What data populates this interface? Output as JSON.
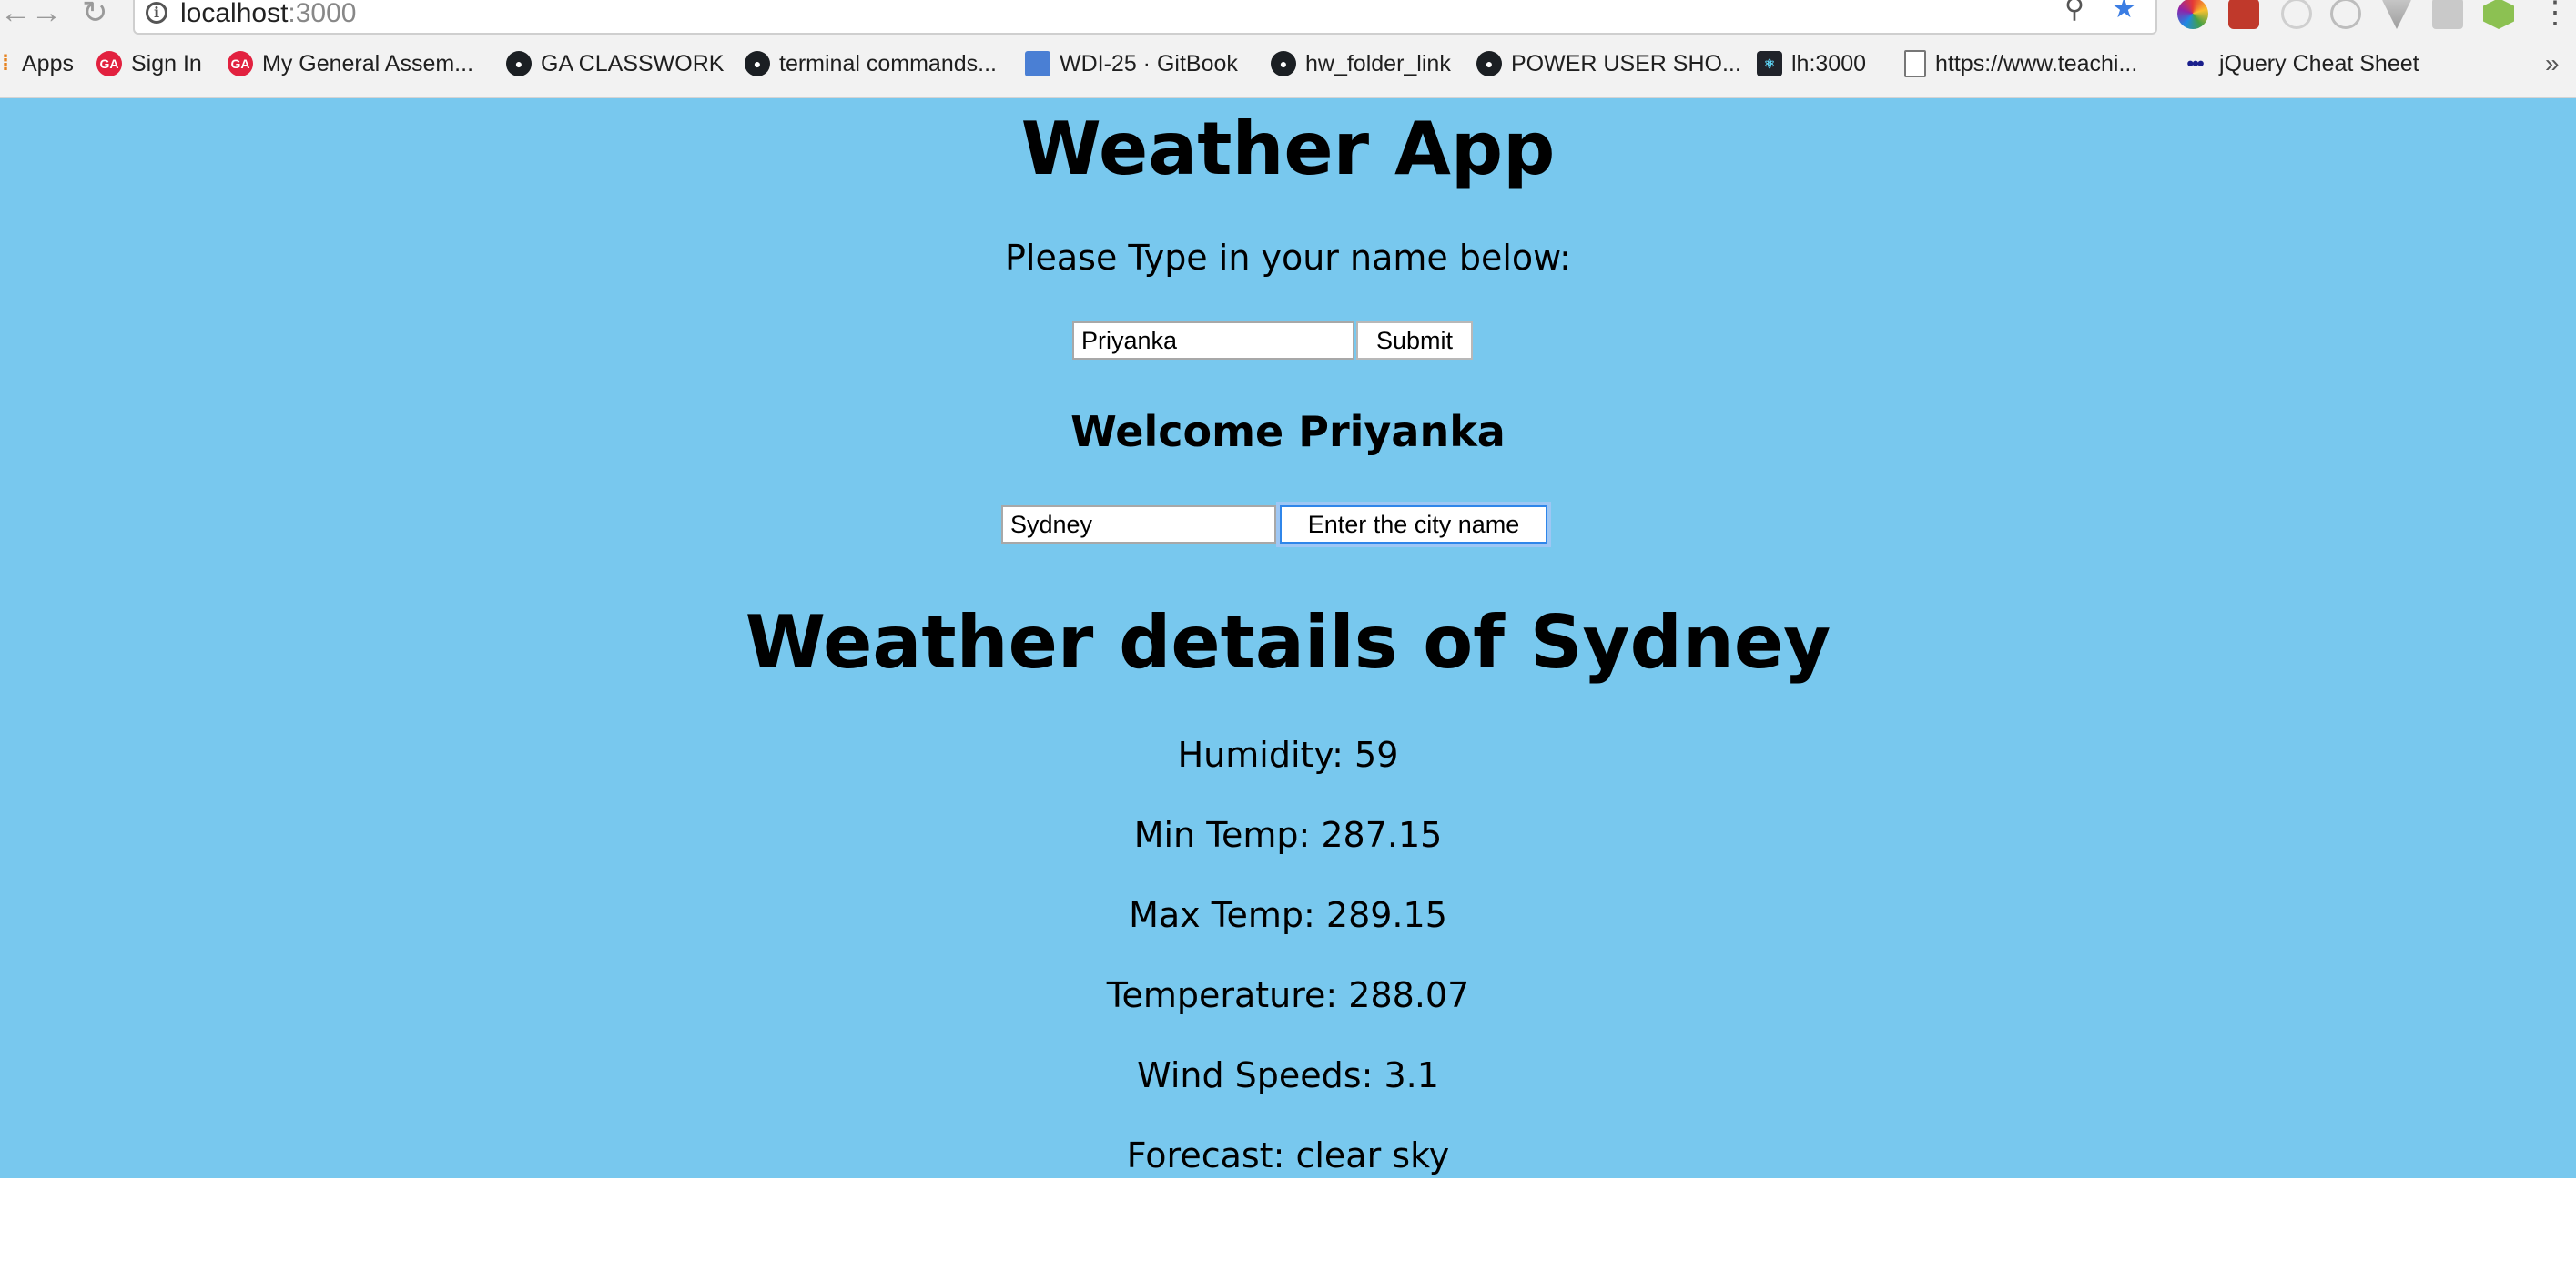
{
  "browser": {
    "url_host": "localhost",
    "url_port": ":3000",
    "bookmarks": [
      {
        "label": "Apps",
        "icon": "apps-grid-icon"
      },
      {
        "label": "Sign In",
        "icon": "ga-icon"
      },
      {
        "label": "My General Assem...",
        "icon": "ga-icon"
      },
      {
        "label": "GA CLASSWORK",
        "icon": "github-icon"
      },
      {
        "label": "terminal commands...",
        "icon": "github-icon"
      },
      {
        "label": "WDI-25 · GitBook",
        "icon": "gitbook-icon"
      },
      {
        "label": "hw_folder_link",
        "icon": "github-icon"
      },
      {
        "label": "POWER USER SHO...",
        "icon": "github-icon"
      },
      {
        "label": "lh:3000",
        "icon": "react-icon"
      },
      {
        "label": "https://www.teachi...",
        "icon": "document-icon"
      },
      {
        "label": "jQuery Cheat Sheet",
        "icon": "dots-icon"
      }
    ],
    "bookmarks_overflow": "»"
  },
  "page": {
    "title": "Weather App",
    "name_prompt": "Please Type in your name below:",
    "name_input_value": "Priyanka",
    "submit_label": "Submit",
    "welcome_text": "Welcome Priyanka",
    "city_input_value": "Sydney",
    "city_button_label": "Enter the city name",
    "details_title": "Weather details of Sydney",
    "details": [
      "Humidity: 59",
      "Min Temp: 287.15",
      "Max Temp: 289.15",
      "Temperature: 288.07",
      "Wind Speeds: 3.1",
      "Forecast: clear sky"
    ]
  },
  "colors": {
    "page_background": "#78c8ee",
    "focus_ring": "#2f86ea"
  }
}
